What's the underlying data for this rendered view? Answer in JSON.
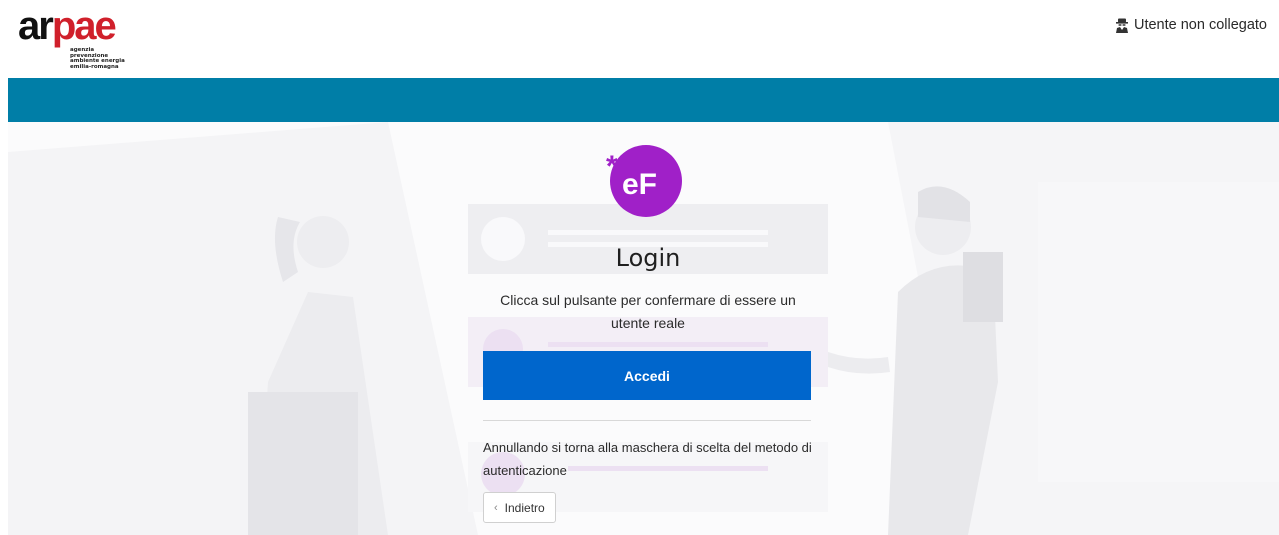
{
  "header": {
    "logo": {
      "wordmark_part1": "ar",
      "wordmark_part2": "pae",
      "tagline": [
        "agenzia",
        "prevenzione",
        "ambiente energia",
        "emilia-romagna"
      ]
    },
    "user_status": "Utente non collegato",
    "user_icon": "user-secret-icon"
  },
  "colors": {
    "band": "#007ea7",
    "primary_button": "#0066cc",
    "badge": "#a020c8"
  },
  "login": {
    "badge_text": "eF",
    "badge_star": "*",
    "title": "Login",
    "description": "Clicca sul pulsante per confermare di essere un utente reale",
    "primary_button": "Accedi",
    "cancel_note": "Annullando si torna alla maschera di scelta del metodo di autenticazione",
    "back_button": "Indietro"
  }
}
